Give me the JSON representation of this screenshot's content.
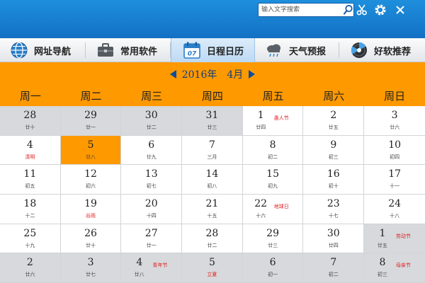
{
  "search": {
    "placeholder": "输入文字搜索"
  },
  "nav": {
    "items": [
      {
        "label": "网址导航",
        "icon": "globe-icon"
      },
      {
        "label": "常用软件",
        "icon": "toolbox-icon"
      },
      {
        "label": "日程日历",
        "icon": "calendar-icon",
        "active": true,
        "icon_text": "07"
      },
      {
        "label": "天气预报",
        "icon": "weather-cloud-icon"
      },
      {
        "label": "好软推荐",
        "icon": "disc-icon"
      }
    ]
  },
  "month": {
    "year_label": "2016年",
    "month_label": "4月"
  },
  "weekdays": [
    "周一",
    "周二",
    "周三",
    "周四",
    "周五",
    "周六",
    "周日"
  ],
  "calendar": {
    "weeks": [
      [
        {
          "day": "28",
          "lunar": "廿十",
          "other": true
        },
        {
          "day": "29",
          "lunar": "廿一",
          "other": true
        },
        {
          "day": "30",
          "lunar": "廿二",
          "other": true
        },
        {
          "day": "31",
          "lunar": "廿三",
          "other": true
        },
        {
          "day": "1",
          "lunar": "廿四",
          "festival": "愚人节"
        },
        {
          "day": "2",
          "lunar": "廿五"
        },
        {
          "day": "3",
          "lunar": "廿六"
        }
      ],
      [
        {
          "day": "4",
          "lunar": "清明",
          "lunar_red": true
        },
        {
          "day": "5",
          "lunar": "廿八",
          "today": true
        },
        {
          "day": "6",
          "lunar": "廿九"
        },
        {
          "day": "7",
          "lunar": "三月"
        },
        {
          "day": "8",
          "lunar": "初二"
        },
        {
          "day": "9",
          "lunar": "初三"
        },
        {
          "day": "10",
          "lunar": "初四"
        }
      ],
      [
        {
          "day": "11",
          "lunar": "初五"
        },
        {
          "day": "12",
          "lunar": "初六"
        },
        {
          "day": "13",
          "lunar": "初七"
        },
        {
          "day": "14",
          "lunar": "初八"
        },
        {
          "day": "15",
          "lunar": "初九"
        },
        {
          "day": "16",
          "lunar": "初十"
        },
        {
          "day": "17",
          "lunar": "十一"
        }
      ],
      [
        {
          "day": "18",
          "lunar": "十二"
        },
        {
          "day": "19",
          "lunar": "谷雨",
          "lunar_red": true
        },
        {
          "day": "20",
          "lunar": "十四"
        },
        {
          "day": "21",
          "lunar": "十五"
        },
        {
          "day": "22",
          "lunar": "十六",
          "festival": "地球日"
        },
        {
          "day": "23",
          "lunar": "十七"
        },
        {
          "day": "24",
          "lunar": "十八"
        }
      ],
      [
        {
          "day": "25",
          "lunar": "十九"
        },
        {
          "day": "26",
          "lunar": "廿十"
        },
        {
          "day": "27",
          "lunar": "廿一"
        },
        {
          "day": "28",
          "lunar": "廿二"
        },
        {
          "day": "29",
          "lunar": "廿三"
        },
        {
          "day": "30",
          "lunar": "廿四"
        },
        {
          "day": "1",
          "lunar": "廿五",
          "other": true,
          "festival": "劳动节"
        }
      ],
      [
        {
          "day": "2",
          "lunar": "廿六",
          "other": true
        },
        {
          "day": "3",
          "lunar": "廿七",
          "other": true
        },
        {
          "day": "4",
          "lunar": "廿八",
          "other": true,
          "festival": "青年节"
        },
        {
          "day": "5",
          "lunar": "立夏",
          "other": true,
          "lunar_red": true
        },
        {
          "day": "6",
          "lunar": "初一",
          "other": true
        },
        {
          "day": "7",
          "lunar": "初二",
          "other": true
        },
        {
          "day": "8",
          "lunar": "初三",
          "other": true,
          "festival": "母亲节"
        }
      ]
    ]
  },
  "colors": {
    "titlebar": "#1a82d4",
    "accent_orange": "#ff9900",
    "holiday_red": "#e02020",
    "arrow_blue": "#0a4d9c"
  }
}
